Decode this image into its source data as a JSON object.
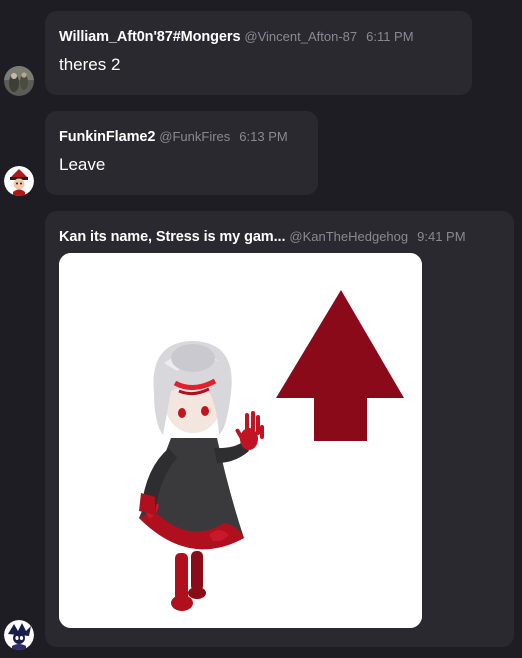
{
  "messages": [
    {
      "name": "William_Aft0n'87#Mongers",
      "handle": "@Vincent_Afton-87",
      "time": "6:11 PM",
      "text": "theres 2"
    },
    {
      "name": "FunkinFlame2",
      "handle": "@FunkFires",
      "time": "6:13 PM",
      "text": "Leave"
    },
    {
      "name": "Kan its name, Stress is my gam...",
      "handle": "@KanTheHedgehog",
      "time": "9:41 PM",
      "image": {
        "subject": "chibi character with white hair and red-black dress",
        "arrow_icon": "arrow-up-icon",
        "arrow_color": "#8b0a1a"
      }
    }
  ],
  "colors": {
    "background": "#1e1d24",
    "bubble": "#2a2930",
    "name_text": "#ffffff",
    "meta_text": "#8a8991"
  }
}
